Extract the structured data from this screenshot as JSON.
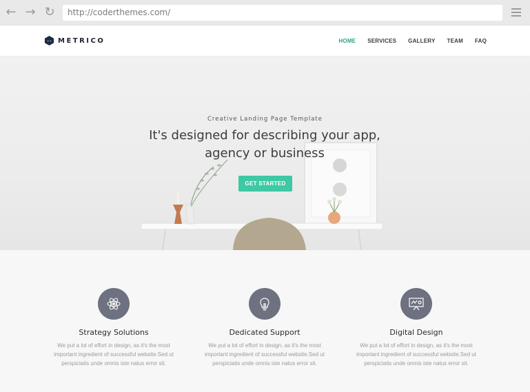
{
  "browser": {
    "url": "http://coderthemes.com/",
    "icons": [
      "back-arrow-icon",
      "forward-arrow-icon",
      "reload-icon",
      "hamburger-menu-icon"
    ]
  },
  "header": {
    "logo_text": "METRICO",
    "nav": [
      {
        "label": "HOME",
        "active": true
      },
      {
        "label": "SERVICES",
        "active": false
      },
      {
        "label": "GALLERY",
        "active": false
      },
      {
        "label": "TEAM",
        "active": false
      },
      {
        "label": "FAQ",
        "active": false
      }
    ]
  },
  "hero": {
    "subtitle": "Creative Landing Page Template",
    "title": "It's designed for describing your app, agency or business",
    "cta_label": "GET STARTED"
  },
  "features": [
    {
      "icon": "atom-icon",
      "title": "Strategy Solutions",
      "text": "We put a lot of effort in design, as it's the most important ingredient of successful website.Sed ut perspiciatis unde omnis iste natus error sit."
    },
    {
      "icon": "lightbulb-icon",
      "title": "Dedicated Support",
      "text": "We put a lot of effort in design, as it's the most important ingredient of successful website.Sed ut perspiciatis unde omnis iste natus error sit."
    },
    {
      "icon": "presentation-board-icon",
      "title": "Digital Design",
      "text": "We put a lot of effort in design, as it's the most important ingredient of successful website.Sed ut perspiciatis unde omnis iste natus error sit."
    }
  ],
  "colors": {
    "accent": "#3fc8a4",
    "active_nav": "#2e9f86",
    "icon_circle": "#6d7180"
  }
}
